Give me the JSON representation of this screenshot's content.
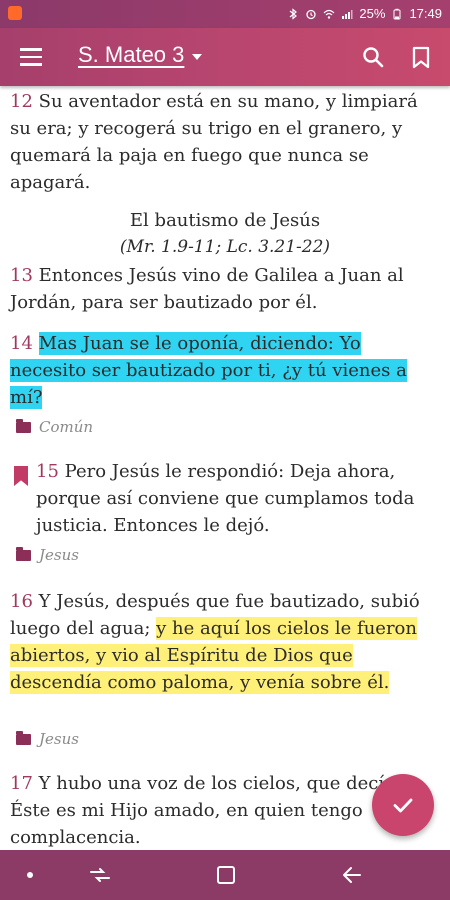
{
  "status": {
    "battery": "25%",
    "time": "17:49",
    "accent": "#9c3d6c"
  },
  "appbar": {
    "title": "S. Mateo 3",
    "menu_icon": "menu-icon",
    "search_icon": "search-icon",
    "bookmark_icon": "bookmark-icon"
  },
  "verses": {
    "v12": {
      "num": "12",
      "text": "Su aventador está en su mano, y limpiará su era; y recogerá su trigo en el granero, y quemará la paja en fuego que nunca se apagará."
    },
    "heading": "El bautismo de Jesús",
    "subheading": "(Mr. 1.9-11; Lc. 3.21-22)",
    "v13": {
      "num": "13",
      "text": "Entonces Jesús vino de Galilea a Juan al Jordán, para ser bautizado por él."
    },
    "v14": {
      "num": "14",
      "text": "Mas Juan se le oponía, diciendo: Yo necesito ser bautizado por ti, ¿y tú vienes a mí?",
      "tag": "Común"
    },
    "v15": {
      "num": "15",
      "text": "Pero Jesús le respondió: Deja ahora, porque así conviene que cumplamos toda justicia. Entonces le dejó.",
      "tag": "Jesus"
    },
    "v16": {
      "num": "16",
      "text_plain": "Y Jesús, después que fue bautizado, subió luego del agua;",
      "text_highlight": "y he aquí los cielos le fueron abiertos, y vio al Espíritu de Dios que descendía como paloma, y venía sobre él.",
      "tag": "Jesus"
    },
    "v17": {
      "num": "17",
      "text": "Y hubo una voz de los cielos, que decía: Éste es mi Hijo amado, en quien tengo complacencia."
    }
  },
  "colors": {
    "highlight_cyan": "#2fd4f2",
    "highlight_yellow": "#fff079",
    "verse_number": "#a0395f",
    "fab": "#c9456d",
    "navbar": "#8c3b67"
  },
  "fab_icon": "check-icon"
}
